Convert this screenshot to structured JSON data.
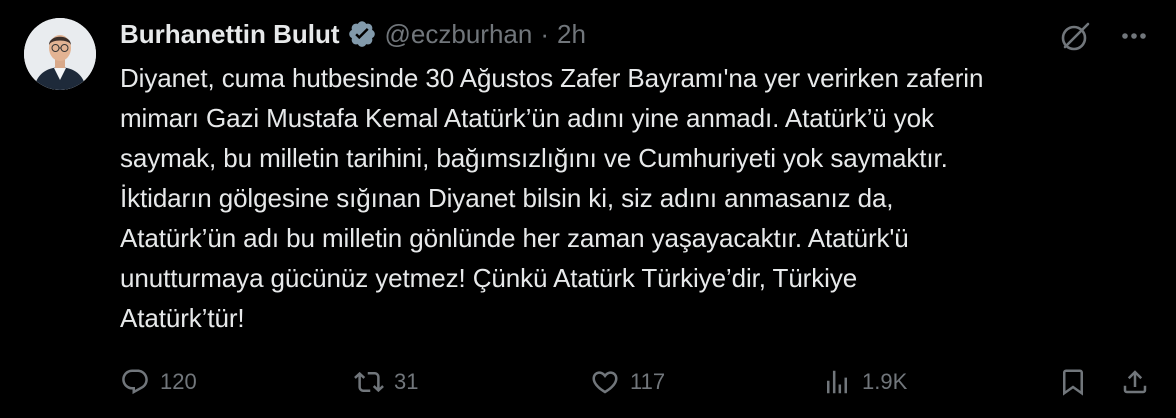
{
  "author": {
    "display_name": "Burhanettin Bulut",
    "handle": "@eczburhan",
    "separator": "·",
    "time": "2h",
    "verified": true
  },
  "tweet_text": "Diyanet, cuma hutbesinde 30 Ağustos Zafer Bayramı'na yer verirken zaferin\nmimarı Gazi Mustafa Kemal Atatürk’ün adını yine anmadı. Atatürk’ü yok\nsaymak, bu milletin tarihini, bağımsızlığını ve Cumhuriyeti yok saymaktır.\nİktidarın gölgesine sığınan Diyanet bilsin ki, siz adını anmasanız da,\nAtatürk’ün adı bu milletin gönlünde her zaman yaşayacaktır. Atatürk'ü\nunutturmaya gücünüz yetmez! Çünkü Atatürk Türkiye’dir, Türkiye\nAtatürk’tür!",
  "stats": {
    "replies": "120",
    "reposts": "31",
    "likes": "117",
    "views": "1.9K"
  },
  "icons": {
    "verified": "verified-badge-icon",
    "grok": "grok-icon",
    "more": "more-icon",
    "reply": "reply-icon",
    "repost": "repost-icon",
    "like": "heart-icon",
    "views": "views-icon",
    "bookmark": "bookmark-icon",
    "share": "share-icon"
  },
  "colors": {
    "background": "#000000",
    "text": "#e7e9ea",
    "secondary": "#71767b"
  }
}
